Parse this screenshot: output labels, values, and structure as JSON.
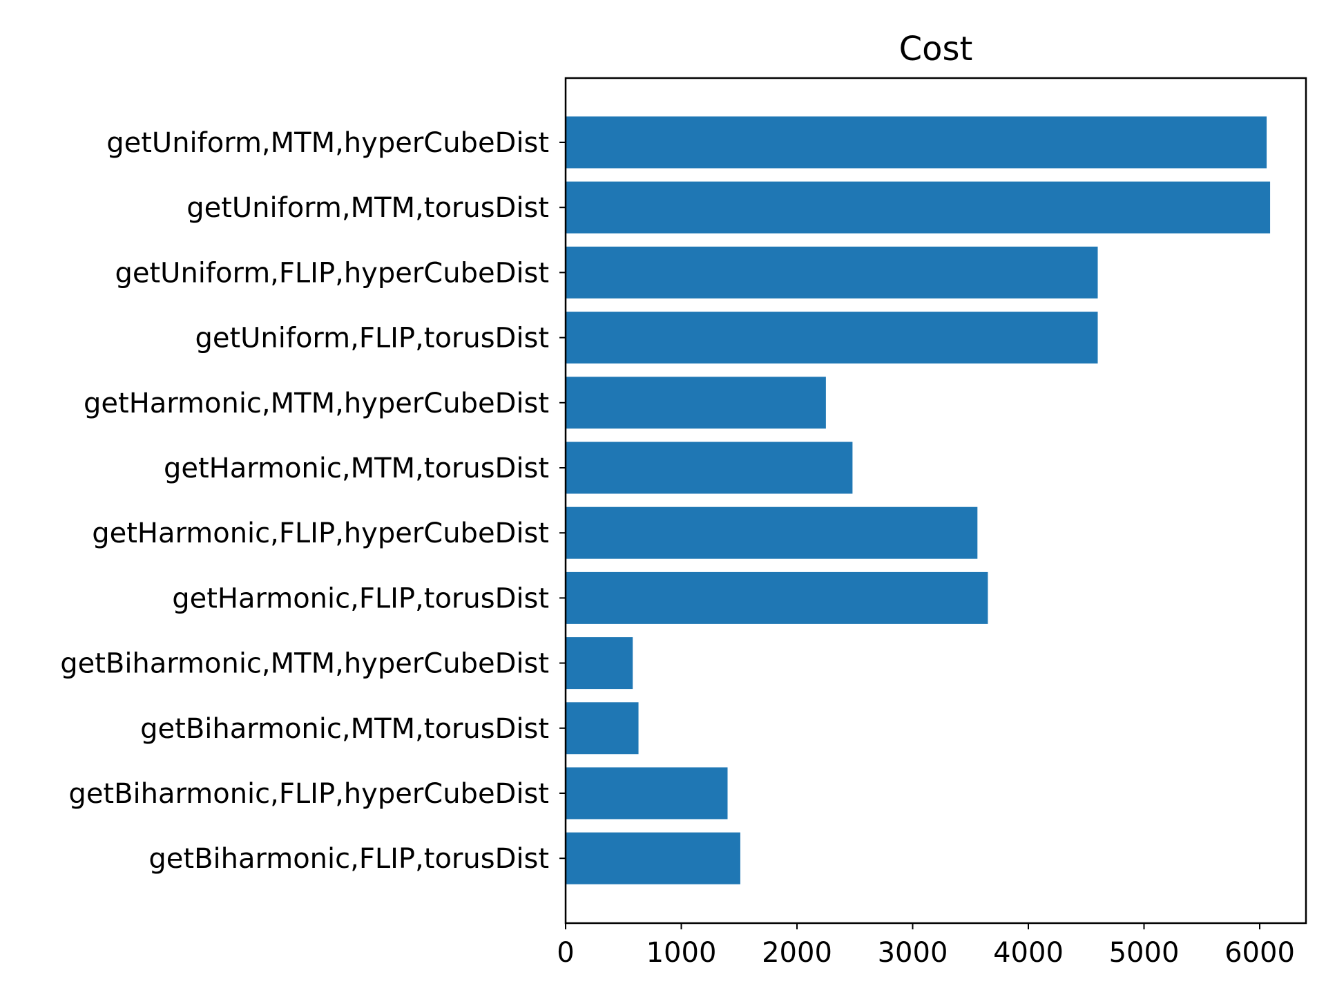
{
  "chart_data": {
    "type": "bar",
    "orientation": "horizontal",
    "title": "Cost",
    "xlabel": "",
    "ylabel": "",
    "color": "#1f77b4",
    "xlim": [
      0,
      6400
    ],
    "xticks": [
      0,
      1000,
      2000,
      3000,
      4000,
      5000,
      6000
    ],
    "grid": false,
    "categories": [
      "getUniform,MTM,hyperCubeDist",
      "getUniform,MTM,torusDist",
      "getUniform,FLIP,hyperCubeDist",
      "getUniform,FLIP,torusDist",
      "getHarmonic,MTM,hyperCubeDist",
      "getHarmonic,MTM,torusDist",
      "getHarmonic,FLIP,hyperCubeDist",
      "getHarmonic,FLIP,torusDist",
      "getBiharmonic,MTM,hyperCubeDist",
      "getBiharmonic,MTM,torusDist",
      "getBiharmonic,FLIP,hyperCubeDist",
      "getBiharmonic,FLIP,torusDist"
    ],
    "values": [
      6060,
      6090,
      4600,
      4600,
      2250,
      2480,
      3560,
      3650,
      580,
      630,
      1400,
      1510
    ]
  }
}
